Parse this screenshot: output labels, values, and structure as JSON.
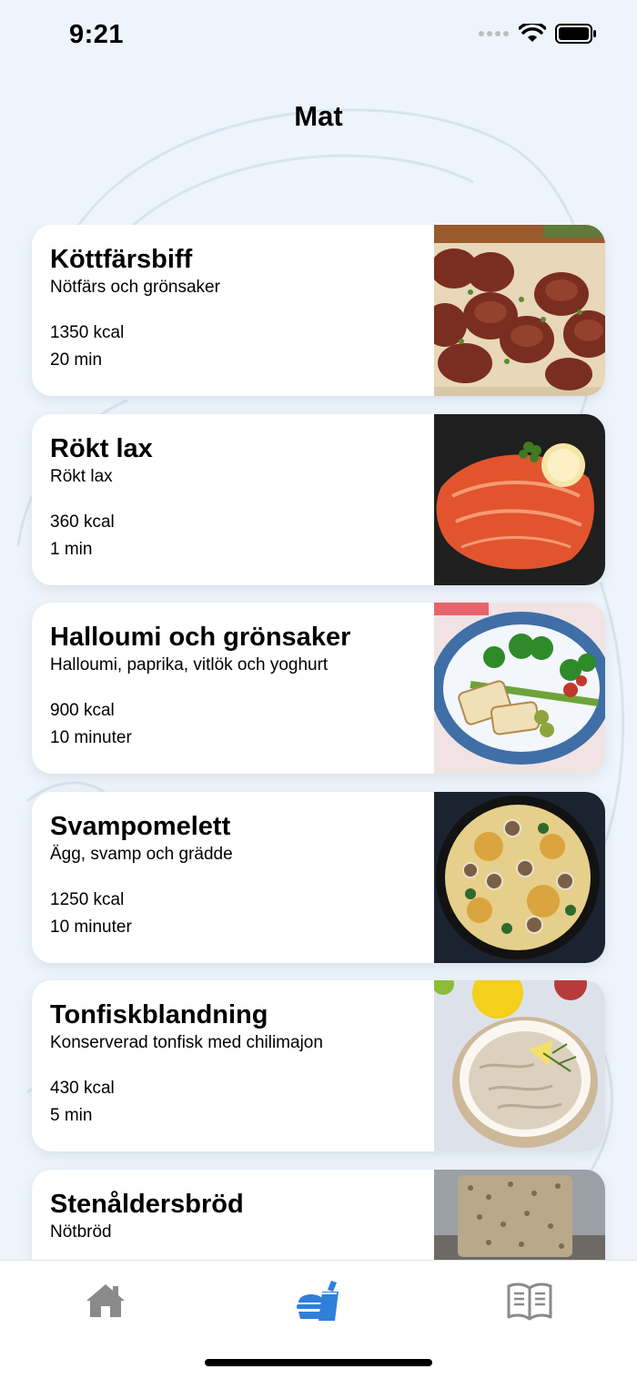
{
  "status_bar": {
    "time": "9:21"
  },
  "header": {
    "title": "Mat"
  },
  "recipes": [
    {
      "title": "Köttfärsbiff",
      "subtitle": "Nötfärs och grönsaker",
      "kcal": "1350 kcal",
      "time": "20 min"
    },
    {
      "title": "Rökt lax",
      "subtitle": "Rökt lax",
      "kcal": "360 kcal",
      "time": "1 min"
    },
    {
      "title": "Halloumi och grönsaker",
      "subtitle": "Halloumi, paprika, vitlök och yoghurt",
      "kcal": "900 kcal",
      "time": "10 minuter"
    },
    {
      "title": "Svampomelett",
      "subtitle": "Ägg, svamp och grädde",
      "kcal": "1250 kcal",
      "time": "10 minuter"
    },
    {
      "title": "Tonfiskblandning",
      "subtitle": "Konserverad tonfisk med chilimajon",
      "kcal": "430 kcal",
      "time": "5 min"
    },
    {
      "title": "Stenåldersbröd",
      "subtitle": "Nötbröd"
    }
  ],
  "tab_bar": {
    "tabs": [
      {
        "icon": "home-icon",
        "active": false
      },
      {
        "icon": "food-icon",
        "active": true
      },
      {
        "icon": "book-icon",
        "active": false
      }
    ]
  },
  "colors": {
    "accent": "#2f80d8",
    "inactive_icon": "#8a8a8a",
    "background": "#eef4fb"
  }
}
